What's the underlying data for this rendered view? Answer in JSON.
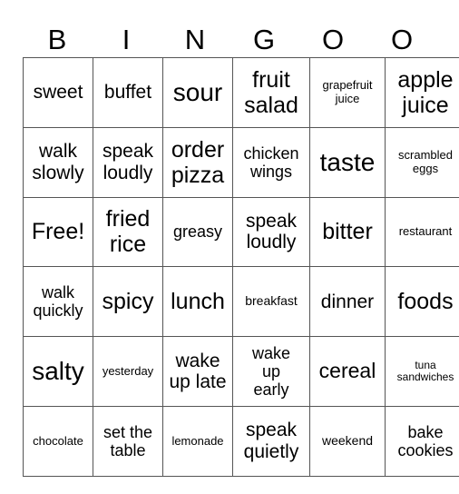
{
  "header": [
    "B",
    "I",
    "N",
    "G",
    "O",
    "O"
  ],
  "grid": [
    [
      "sweet",
      "buffet",
      "sour",
      "fruit salad",
      "grapefruit juice",
      "apple juice"
    ],
    [
      "walk slowly",
      "speak loudly",
      "order pizza",
      "chicken wings",
      "taste",
      "scrambled eggs"
    ],
    [
      "Free!",
      "fried rice",
      "greasy",
      "speak loudly",
      "bitter",
      "restaurant"
    ],
    [
      "walk quickly",
      "spicy",
      "lunch",
      "breakfast",
      "dinner",
      "foods"
    ],
    [
      "salty",
      "yesterday",
      "wake up late",
      "wake up early",
      "cereal",
      "tuna sandwiches"
    ],
    [
      "chocolate",
      "set the table",
      "lemonade",
      "speak quietly",
      "weekend",
      "bake cookies"
    ]
  ]
}
